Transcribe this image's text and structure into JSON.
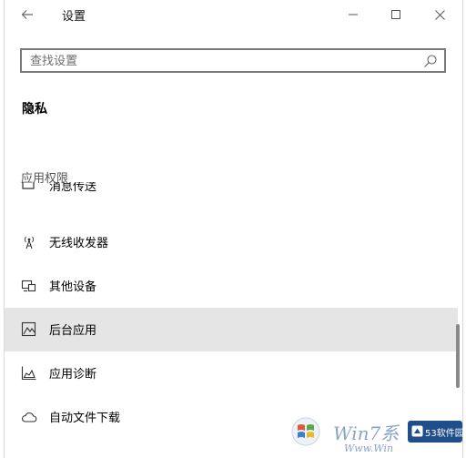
{
  "window": {
    "title": "设置",
    "back_icon": "back-arrow-icon",
    "controls": {
      "minimize_icon": "minimize-icon",
      "maximize_icon": "maximize-icon",
      "close_icon": "close-icon"
    }
  },
  "search": {
    "placeholder": "查找设置",
    "value": "",
    "icon": "search-icon"
  },
  "page": {
    "heading": "隐私",
    "section_label": "应用权限"
  },
  "nav": {
    "items": [
      {
        "label": "消息传送",
        "icon": "message-icon",
        "selected": false
      },
      {
        "label": "无线收发器",
        "icon": "radio-antenna-icon",
        "selected": false
      },
      {
        "label": "其他设备",
        "icon": "devices-icon",
        "selected": false
      },
      {
        "label": "后台应用",
        "icon": "background-apps-icon",
        "selected": true
      },
      {
        "label": "应用诊断",
        "icon": "app-diagnostics-icon",
        "selected": false
      },
      {
        "label": "自动文件下载",
        "icon": "cloud-icon",
        "selected": false
      }
    ]
  },
  "watermark": {
    "brand": "Win7系",
    "url": "Www.Win",
    "badge": "53软件园"
  },
  "colors": {
    "selected_background": "#e5e5e5",
    "scrollbar": "#8a8a8a",
    "search_border": "#7a7a7a"
  }
}
